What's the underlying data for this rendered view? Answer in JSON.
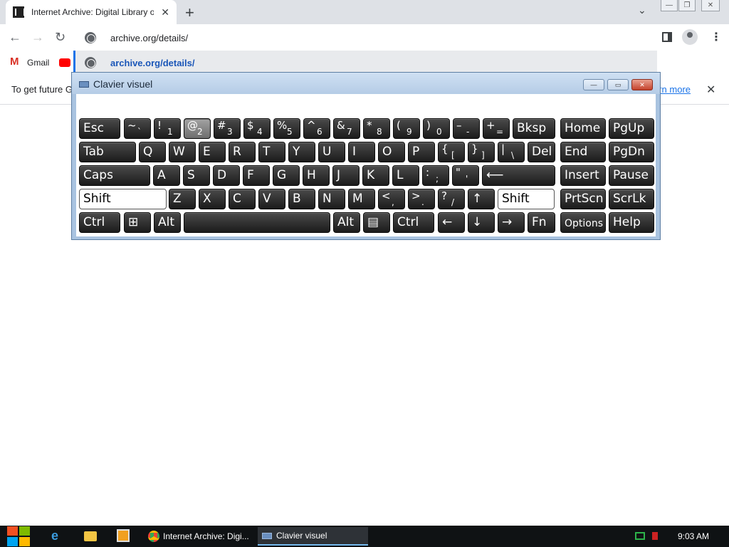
{
  "browser": {
    "tab_title": "Internet Archive: Digital Library o",
    "tab_close": "✕",
    "new_tab": "+",
    "tab_list": "⌄",
    "window_controls": [
      "—",
      "❐",
      "✕"
    ],
    "nav": {
      "back": "←",
      "forward": "→",
      "reload": "↻"
    },
    "url": "archive.org/details/",
    "suggestion": "archive.org/details/",
    "menu": "⋮",
    "bookmarks": [
      {
        "label": "Gmail",
        "icon": "gmail-icon"
      },
      {
        "label": "",
        "icon": "youtube-icon"
      }
    ],
    "infobar": {
      "text": "To get future G",
      "link": "arn more",
      "close": "✕"
    }
  },
  "osk": {
    "title": "Clavier visuel",
    "buttons": {
      "minimize": "—",
      "maximize": "▭",
      "close": "✕"
    },
    "rows": [
      [
        {
          "m": "Esc"
        },
        {
          "s": "~",
          "b": "`"
        },
        {
          "s": "!",
          "b": "1"
        },
        {
          "s": "@",
          "b": "2",
          "pressed": true
        },
        {
          "s": "#",
          "b": "3"
        },
        {
          "s": "$",
          "b": "4"
        },
        {
          "s": "%",
          "b": "5"
        },
        {
          "s": "^",
          "b": "6"
        },
        {
          "s": "&",
          "b": "7"
        },
        {
          "s": "*",
          "b": "8"
        },
        {
          "s": "(",
          "b": "9"
        },
        {
          "s": ")",
          "b": "0"
        },
        {
          "s": "–",
          "b": "-"
        },
        {
          "s": "+",
          "b": "="
        },
        {
          "m": "Bksp"
        },
        {
          "m": "Home"
        },
        {
          "m": "PgUp"
        }
      ],
      [
        {
          "m": "Tab"
        },
        {
          "m": "Q"
        },
        {
          "m": "W"
        },
        {
          "m": "E"
        },
        {
          "m": "R"
        },
        {
          "m": "T"
        },
        {
          "m": "Y"
        },
        {
          "m": "U"
        },
        {
          "m": "I"
        },
        {
          "m": "O"
        },
        {
          "m": "P"
        },
        {
          "s": "{",
          "b": "["
        },
        {
          "s": "}",
          "b": "]"
        },
        {
          "s": "|",
          "b": "\\"
        },
        {
          "m": "Del"
        },
        {
          "m": "End"
        },
        {
          "m": "PgDn"
        }
      ],
      [
        {
          "m": "Caps"
        },
        {
          "m": "A"
        },
        {
          "m": "S"
        },
        {
          "m": "D"
        },
        {
          "m": "F"
        },
        {
          "m": "G"
        },
        {
          "m": "H"
        },
        {
          "m": "J"
        },
        {
          "m": "K"
        },
        {
          "m": "L"
        },
        {
          "s": ":",
          "b": ";"
        },
        {
          "s": "\"",
          "b": "'"
        },
        {
          "m": "⟵"
        },
        {
          "m": "Insert"
        },
        {
          "m": "Pause"
        }
      ],
      [
        {
          "m": "Shift",
          "white": true
        },
        {
          "m": "Z"
        },
        {
          "m": "X"
        },
        {
          "m": "C"
        },
        {
          "m": "V"
        },
        {
          "m": "B"
        },
        {
          "m": "N"
        },
        {
          "m": "M"
        },
        {
          "s": "<",
          "b": ","
        },
        {
          "s": ">",
          "b": "."
        },
        {
          "s": "?",
          "b": "/"
        },
        {
          "m": "↑"
        },
        {
          "m": "Shift",
          "white": true
        },
        {
          "m": "PrtScn"
        },
        {
          "m": "ScrLk"
        }
      ],
      [
        {
          "m": "Ctrl"
        },
        {
          "m": "⊞"
        },
        {
          "m": "Alt"
        },
        {
          "m": ""
        },
        {
          "m": "Alt"
        },
        {
          "m": "▤"
        },
        {
          "m": "Ctrl"
        },
        {
          "m": "←"
        },
        {
          "m": "↓"
        },
        {
          "m": "→"
        },
        {
          "m": "Fn"
        },
        {
          "m": "Options",
          "small": true
        },
        {
          "m": "Help"
        }
      ]
    ]
  },
  "taskbar": {
    "tasks": [
      {
        "label": "Internet Archive: Digi...",
        "icon": "chrome-icon"
      },
      {
        "label": "Clavier visuel",
        "icon": "keyboard-icon"
      }
    ],
    "clock": "9:03 AM"
  }
}
